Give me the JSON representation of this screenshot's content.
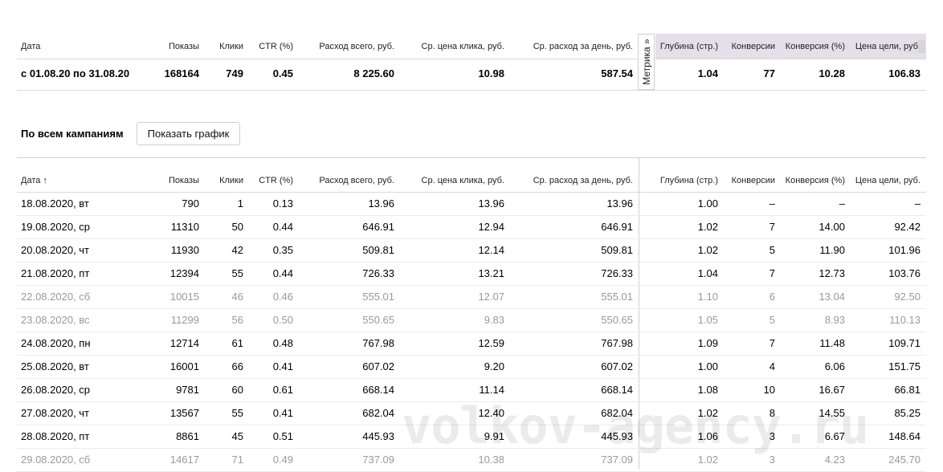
{
  "columns": [
    "Дата",
    "Показы",
    "Клики",
    "CTR (%)",
    "Расход всего, руб.",
    "Ср. цена клика, руб.",
    "Ср. расход за день, руб.",
    "Глубина (стр.)",
    "Конверсии",
    "Конверсия (%)",
    "Цена цели, руб."
  ],
  "metrika_tab": "Метрика »",
  "summary": {
    "period": "с 01.08.20 по 31.08.20",
    "impressions": "168164",
    "clicks": "749",
    "ctr": "0.45",
    "spend": "8 225.60",
    "avg_cpc": "10.98",
    "avg_daily": "587.54",
    "depth": "1.04",
    "conversions": "77",
    "conv_rate": "10.28",
    "goal_cost": "106.83"
  },
  "section_title": "По всем кампаниям",
  "show_chart_button": "Показать график",
  "table_date_header": "Дата ↑",
  "rows": [
    {
      "date": "18.08.2020, вт",
      "impr": "790",
      "clicks": "1",
      "ctr": "0.13",
      "spend": "13.96",
      "cpc": "13.96",
      "daily": "13.96",
      "depth": "1.00",
      "conv": "–",
      "rate": "–",
      "cost": "–",
      "weekend": false
    },
    {
      "date": "19.08.2020, ср",
      "impr": "11310",
      "clicks": "50",
      "ctr": "0.44",
      "spend": "646.91",
      "cpc": "12.94",
      "daily": "646.91",
      "depth": "1.02",
      "conv": "7",
      "rate": "14.00",
      "cost": "92.42",
      "weekend": false
    },
    {
      "date": "20.08.2020, чт",
      "impr": "11930",
      "clicks": "42",
      "ctr": "0.35",
      "spend": "509.81",
      "cpc": "12.14",
      "daily": "509.81",
      "depth": "1.02",
      "conv": "5",
      "rate": "11.90",
      "cost": "101.96",
      "weekend": false
    },
    {
      "date": "21.08.2020, пт",
      "impr": "12394",
      "clicks": "55",
      "ctr": "0.44",
      "spend": "726.33",
      "cpc": "13.21",
      "daily": "726.33",
      "depth": "1.04",
      "conv": "7",
      "rate": "12.73",
      "cost": "103.76",
      "weekend": false
    },
    {
      "date": "22.08.2020, сб",
      "impr": "10015",
      "clicks": "46",
      "ctr": "0.46",
      "spend": "555.01",
      "cpc": "12.07",
      "daily": "555.01",
      "depth": "1.10",
      "conv": "6",
      "rate": "13.04",
      "cost": "92.50",
      "weekend": true
    },
    {
      "date": "23.08.2020, вс",
      "impr": "11299",
      "clicks": "56",
      "ctr": "0.50",
      "spend": "550.65",
      "cpc": "9.83",
      "daily": "550.65",
      "depth": "1.05",
      "conv": "5",
      "rate": "8.93",
      "cost": "110.13",
      "weekend": true
    },
    {
      "date": "24.08.2020, пн",
      "impr": "12714",
      "clicks": "61",
      "ctr": "0.48",
      "spend": "767.98",
      "cpc": "12.59",
      "daily": "767.98",
      "depth": "1.09",
      "conv": "7",
      "rate": "11.48",
      "cost": "109.71",
      "weekend": false
    },
    {
      "date": "25.08.2020, вт",
      "impr": "16001",
      "clicks": "66",
      "ctr": "0.41",
      "spend": "607.02",
      "cpc": "9.20",
      "daily": "607.02",
      "depth": "1.00",
      "conv": "4",
      "rate": "6.06",
      "cost": "151.75",
      "weekend": false
    },
    {
      "date": "26.08.2020, ср",
      "impr": "9781",
      "clicks": "60",
      "ctr": "0.61",
      "spend": "668.14",
      "cpc": "11.14",
      "daily": "668.14",
      "depth": "1.08",
      "conv": "10",
      "rate": "16.67",
      "cost": "66.81",
      "weekend": false
    },
    {
      "date": "27.08.2020, чт",
      "impr": "13567",
      "clicks": "55",
      "ctr": "0.41",
      "spend": "682.04",
      "cpc": "12.40",
      "daily": "682.04",
      "depth": "1.02",
      "conv": "8",
      "rate": "14.55",
      "cost": "85.25",
      "weekend": false
    },
    {
      "date": "28.08.2020, пт",
      "impr": "8861",
      "clicks": "45",
      "ctr": "0.51",
      "spend": "445.93",
      "cpc": "9.91",
      "daily": "445.93",
      "depth": "1.06",
      "conv": "3",
      "rate": "6.67",
      "cost": "148.64",
      "weekend": false
    },
    {
      "date": "29.08.2020, сб",
      "impr": "14617",
      "clicks": "71",
      "ctr": "0.49",
      "spend": "737.09",
      "cpc": "10.38",
      "daily": "737.09",
      "depth": "1.02",
      "conv": "3",
      "rate": "4.23",
      "cost": "245.70",
      "weekend": true
    }
  ],
  "watermark": "volkov-agency.ru"
}
